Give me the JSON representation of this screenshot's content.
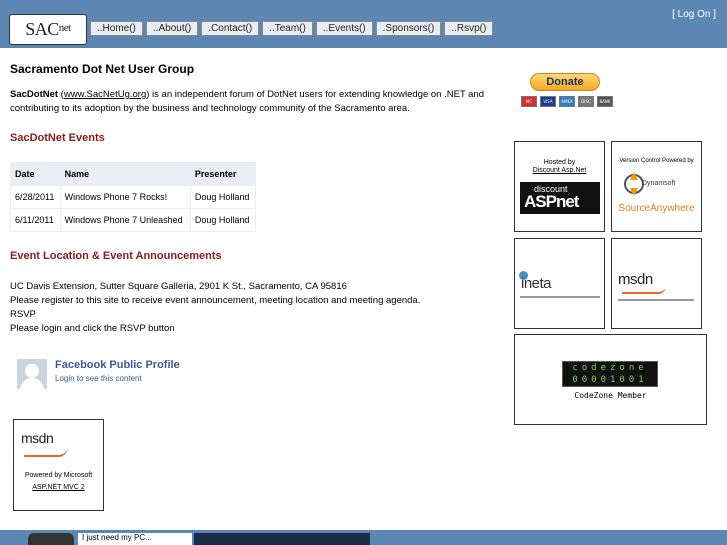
{
  "header": {
    "logo": {
      "text": "SAC",
      "sup": "net"
    },
    "menu": [
      {
        "label": "..Home()"
      },
      {
        "label": "..About()"
      },
      {
        "label": ".Contact()"
      },
      {
        "label": "..Team()"
      },
      {
        "label": "..Events()"
      },
      {
        "label": ".Sponsors()"
      },
      {
        "label": "..Rsvp()"
      }
    ],
    "logon": "[ Log On ]"
  },
  "main": {
    "title": "Sacramento Dot Net User Group",
    "intro": {
      "bold": "SacDotNet",
      "paren_open": " (",
      "link": "www.SacNetUg.org",
      "rest": ") is an independent forum of DotNet users for extending knowledge on .NET and contributing to its adoption by the business and technology community of the Sacramento area."
    },
    "events_heading": "SacDotNet Events",
    "events_table": {
      "headers": [
        "Date",
        "Name",
        "Presenter"
      ],
      "rows": [
        [
          "6/28/2011",
          "Windows Phone 7 Rocks!",
          "Doug Holland"
        ],
        [
          "6/11/2011",
          "Windows Phone 7 Unleashed",
          "Doug Holland"
        ]
      ]
    },
    "location_heading": "Event Location & Event Announcements",
    "location_lines": [
      "UC Davis Extension, Sutter Square Galleria, 2901 K St., Sacramento, CA 95816",
      "Please register to this site to receive event announcement, meeting location and meeting agenda.",
      "RSVP",
      "Please login and click the RSVP button"
    ],
    "facebook": {
      "title": "Facebook Public Profile",
      "link": "Login to see this content"
    },
    "msdn_box": {
      "logo": "msdn",
      "powered_by": "Powered by Microsoft",
      "link": "ASP.NET MVC 2"
    }
  },
  "sidebar": {
    "donate": "Donate",
    "cards": [
      {
        "name": "MC",
        "color": "#d32f2f"
      },
      {
        "name": "VISA",
        "color": "#1a3d8f"
      },
      {
        "name": "AMEX",
        "color": "#2e7dc0"
      },
      {
        "name": "DISC",
        "color": "#777777"
      },
      {
        "name": "BANK",
        "color": "#555555"
      }
    ],
    "hosted": {
      "line1": "Hosted by",
      "line2": "Discount Asp.Net",
      "logo_top": "discount",
      "logo_main": "ASPnet"
    },
    "sourceanywhere": {
      "top": "Version Control Powered by",
      "brand": "Dynamsoft",
      "name": "SourceAnywhere"
    },
    "ineta": {
      "name": "ineta"
    },
    "msdn": {
      "name": "msdn"
    },
    "codezone": {
      "row1": "codezone",
      "row2": "00001001",
      "label": "CodeZone Member"
    }
  },
  "footer": {
    "snippet": "I just need my PC..."
  }
}
